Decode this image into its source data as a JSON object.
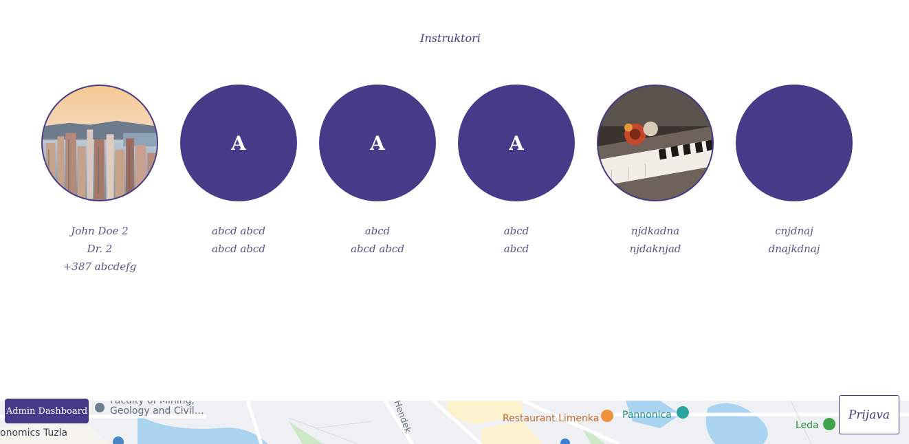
{
  "section": {
    "title": "Instruktori"
  },
  "colors": {
    "accent": "#473b89",
    "text_muted": "#5a5283"
  },
  "instructors": [
    {
      "image": "city-skyline-photo",
      "initial": "",
      "lines": [
        "John Doe 2",
        "Dr. 2",
        "+387 abcdefg"
      ]
    },
    {
      "image": "",
      "initial": "A",
      "lines": [
        "abcd abcd",
        "abcd abcd"
      ]
    },
    {
      "image": "",
      "initial": "A",
      "lines": [
        "abcd",
        "abcd abcd"
      ]
    },
    {
      "image": "",
      "initial": "A",
      "lines": [
        "abcd",
        "abcd"
      ]
    },
    {
      "image": "piano-flower-photo",
      "initial": "",
      "lines": [
        "njdkadna",
        "njdaknjad"
      ]
    },
    {
      "image": "",
      "initial": "",
      "lines": [
        "cnjdnaj",
        "dnajkdnaj"
      ]
    }
  ],
  "map": {
    "labels": {
      "faculty": "Faculty of Mining,",
      "faculty2": "Geology and Civil…",
      "economics": "onomics Tuzla",
      "street": "Hendek",
      "restaurant": "Restaurant Limenka",
      "pannonica": "Pannonica",
      "leda": "Leda"
    }
  },
  "buttons": {
    "admin": "Admin Dashboard",
    "login": "Prijava"
  }
}
